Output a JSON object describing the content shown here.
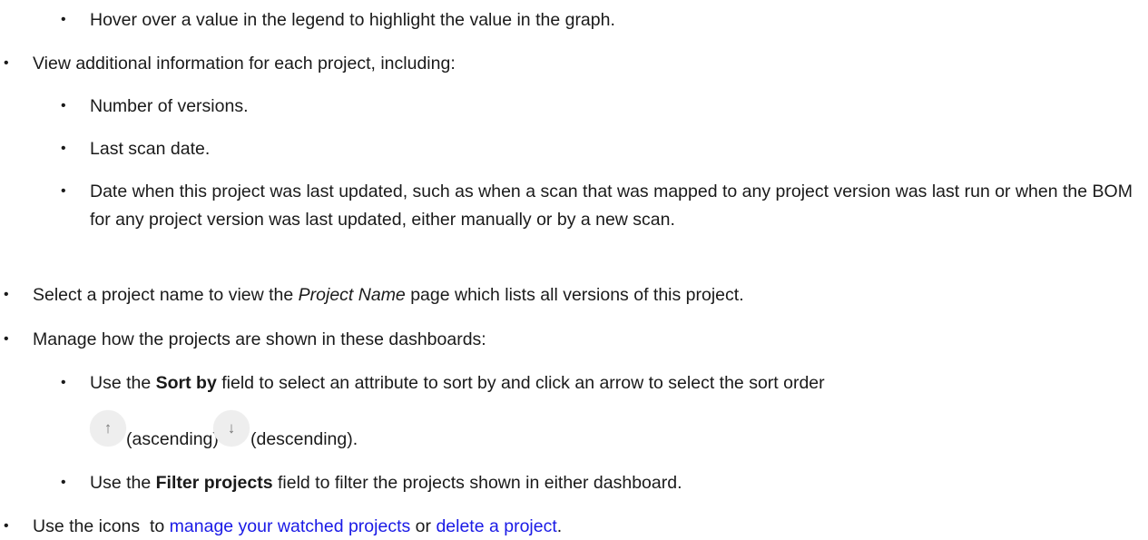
{
  "bullet_char": "•",
  "items": {
    "hover_legend": "Hover over a value in the legend to highlight the value in the graph.",
    "view_info": "View additional information for each project, including:",
    "num_versions": "Number of versions.",
    "last_scan": "Last scan date.",
    "date_updated": "Date when this project was last updated, such as when a scan that was mapped to any project version was last run or when the BOM for any project version was last updated, either manually or by a new scan.",
    "select_project_prefix": "Select a project name to view the ",
    "select_project_italic": "Project Name",
    "select_project_suffix": " page which lists all versions of this project.",
    "manage_how": "Manage how the projects are shown in these dashboards:",
    "sort_prefix": "Use the ",
    "sort_bold": "Sort by",
    "sort_suffix": " field to select an attribute to sort by and click an arrow to select the sort order",
    "ascending_label": "(ascending) or",
    "descending_label": "(descending).",
    "filter_prefix": "Use the ",
    "filter_bold": "Filter projects",
    "filter_suffix": " field to filter the projects shown in either dashboard.",
    "icons_prefix": "Use the icons  to ",
    "link_watched": "manage your watched projects",
    "icons_or": " or ",
    "link_delete": "delete a project",
    "icons_end": "."
  },
  "icons": {
    "ascending_glyph": "↑",
    "descending_glyph": "↓"
  },
  "colors": {
    "link": "#1a1ae6",
    "text": "#1a1a1a",
    "icon_bg": "#eeeeee"
  }
}
